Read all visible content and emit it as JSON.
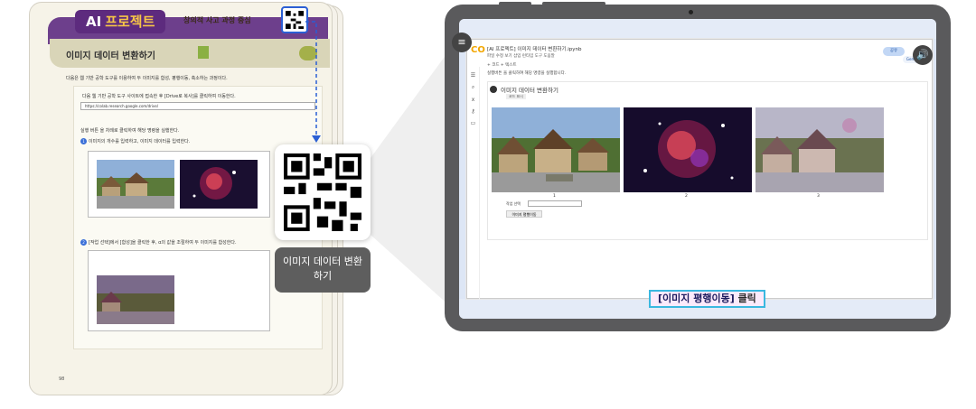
{
  "book": {
    "tag_ai": "AI",
    "tag_project": "프로젝트",
    "subtitle": "창의적 사고 과정 중심",
    "lesson_title": "이미지 데이터 변환하기",
    "intro_text": "다음은 웹 기반 공학 도구를 이용하여 두 이미지를 합성, 평행이동, 축소하는 과정이다.",
    "instruction_1": "다음 웹 기반 공학 도구 사이트에 접속한 후 [Drive로 복사]를 클릭하여 이동한다.",
    "url": "https://colab.research.google.com/drive/",
    "run_instruction": "실행 버튼 을 차례로 클릭하여 해당 명령을 실행한다.",
    "step_1": "이미지의 개수를 입력하고, 이미지 데이터를 입력한다.",
    "step_2": "[작업 선택]에서 [합성]을 클릭한 후, α의 값을 조절하여 두 이미지를 합성한다.",
    "page_number": "98"
  },
  "qr_popup": {
    "label_line1": "이미지 데이터 변환",
    "label_line2": "하기"
  },
  "colab": {
    "logo": "CO",
    "file_title": "[AI 프로젝트] 이미지 데이터 변환하기.ipynb",
    "menu": "파일  수정  보기  삽입  런타임  도구  도움말",
    "share_label": "공유",
    "gemini_label": "Gemini",
    "toolbar": "+ 코드   + 텍스트",
    "cell_hint": "실행버튼 을 클릭하여 해당 명령을 실행합니다.",
    "cell_heading": "이미지 데이터 변환하기",
    "show_code": "코드 표시",
    "captions": [
      "1",
      "2",
      "3"
    ],
    "select_label": "작업 선택",
    "select_value": "",
    "action_button": "이미지 평행이동"
  },
  "hint": {
    "prefix": "[이미지 평행이동]",
    "suffix": " 클릭"
  },
  "colors": {
    "purple": "#6d3f8c",
    "accent_yellow": "#f6c547",
    "qr_highlight": "#2b5fd4",
    "hint_border": "#3ab8e0"
  }
}
